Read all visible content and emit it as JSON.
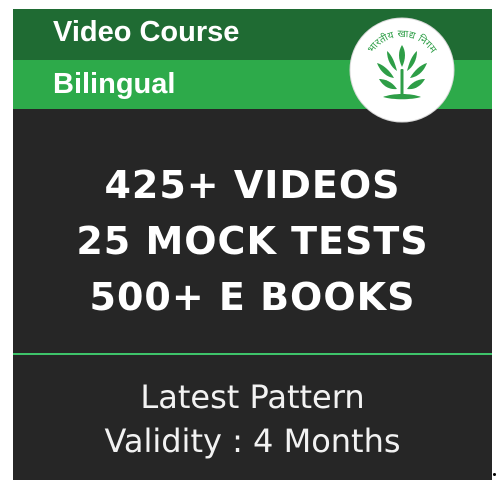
{
  "banner": {
    "title": "Video Course",
    "subtitle": "Bilingual"
  },
  "logo": {
    "text": "भारतीय खाद्य निगम",
    "icon": "wheat-sheaf-emblem",
    "color": "#2e9e47"
  },
  "highlights": [
    "425+ VIDEOS",
    "25 MOCK TESTS",
    "500+ E BOOKS"
  ],
  "footer": {
    "line1": "Latest Pattern",
    "line2": "Validity : 4 Months"
  },
  "colors": {
    "background": "#262626",
    "band_dark": "#1f6b33",
    "band_light": "#2daa4a",
    "divider": "#3ec36a"
  }
}
